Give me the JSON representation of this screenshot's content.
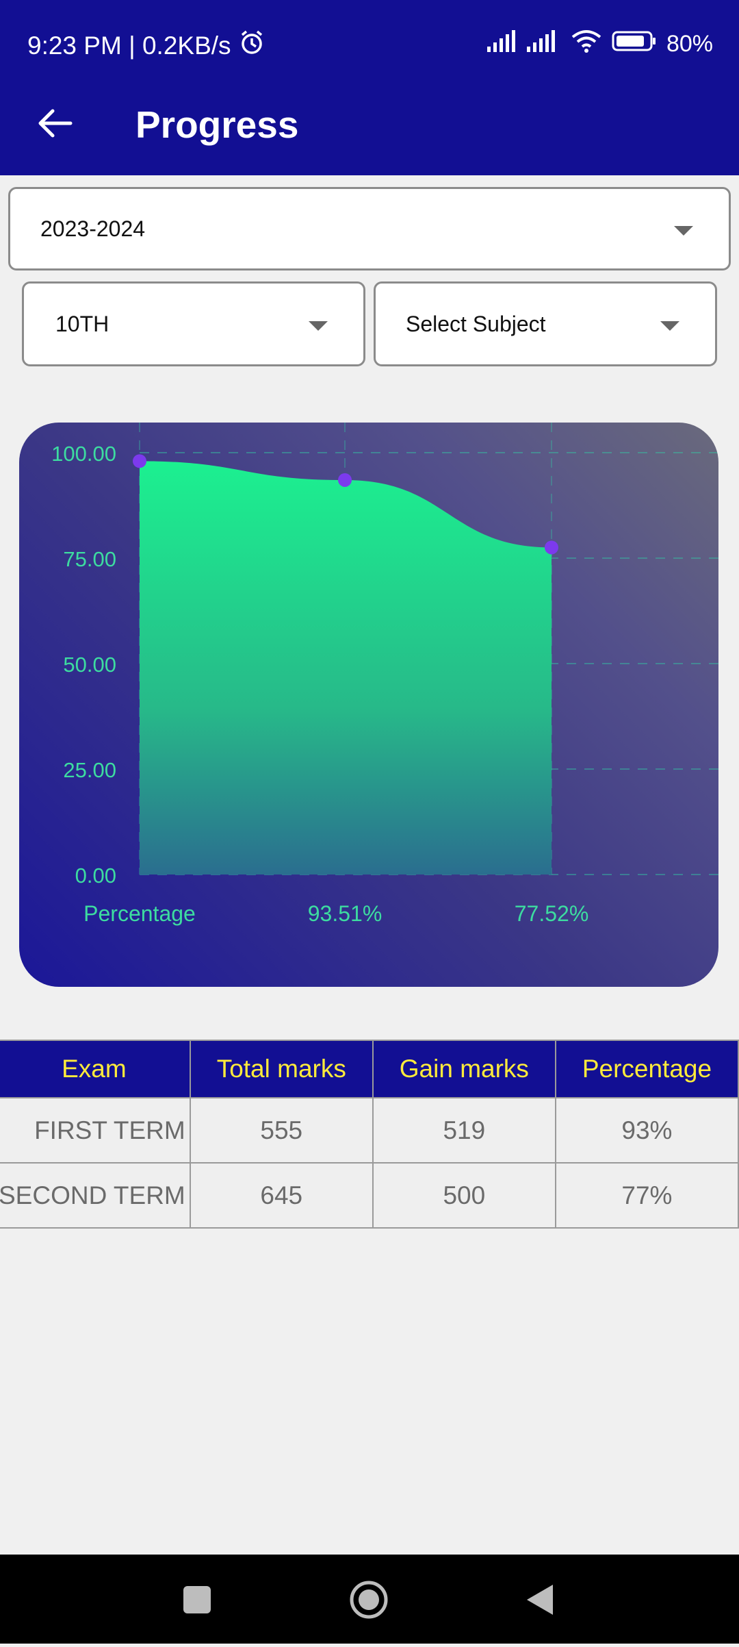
{
  "status": {
    "left_text": "9:23 PM | 0.2KB/s",
    "battery": "80%",
    "alarm_icon": "alarm-icon",
    "signal_icon": "signal-icon",
    "wifi_icon": "wifi-icon"
  },
  "appbar": {
    "title": "Progress",
    "back_icon": "back-arrow-icon"
  },
  "filters": {
    "year": "2023-2024",
    "class": "10TH",
    "subject_placeholder": "Select Subject"
  },
  "chart_data": {
    "type": "area",
    "x": [
      "Percentage",
      "93.51%",
      "77.52%"
    ],
    "values": [
      98,
      93.51,
      77.52
    ],
    "yticks": [
      "100.00",
      "75.00",
      "50.00",
      "25.00",
      "0.00"
    ],
    "ylim": [
      0,
      100
    ],
    "grid": true,
    "colors": {
      "fill_top": "#1cf090",
      "fill_bottom": "#2a6e8f",
      "point": "#7c3aed",
      "label": "#3ddca0"
    }
  },
  "table": {
    "headers": [
      "Exam",
      "Total marks",
      "Gain marks",
      "Percentage"
    ],
    "rows": [
      [
        "FIRST TERM",
        "555",
        "519",
        "93%"
      ],
      [
        "SECOND TERM",
        "645",
        "500",
        "77%"
      ]
    ]
  },
  "navbar": {
    "recent_icon": "recent-apps-icon",
    "home_icon": "home-icon",
    "back_icon": "back-triangle-icon"
  }
}
